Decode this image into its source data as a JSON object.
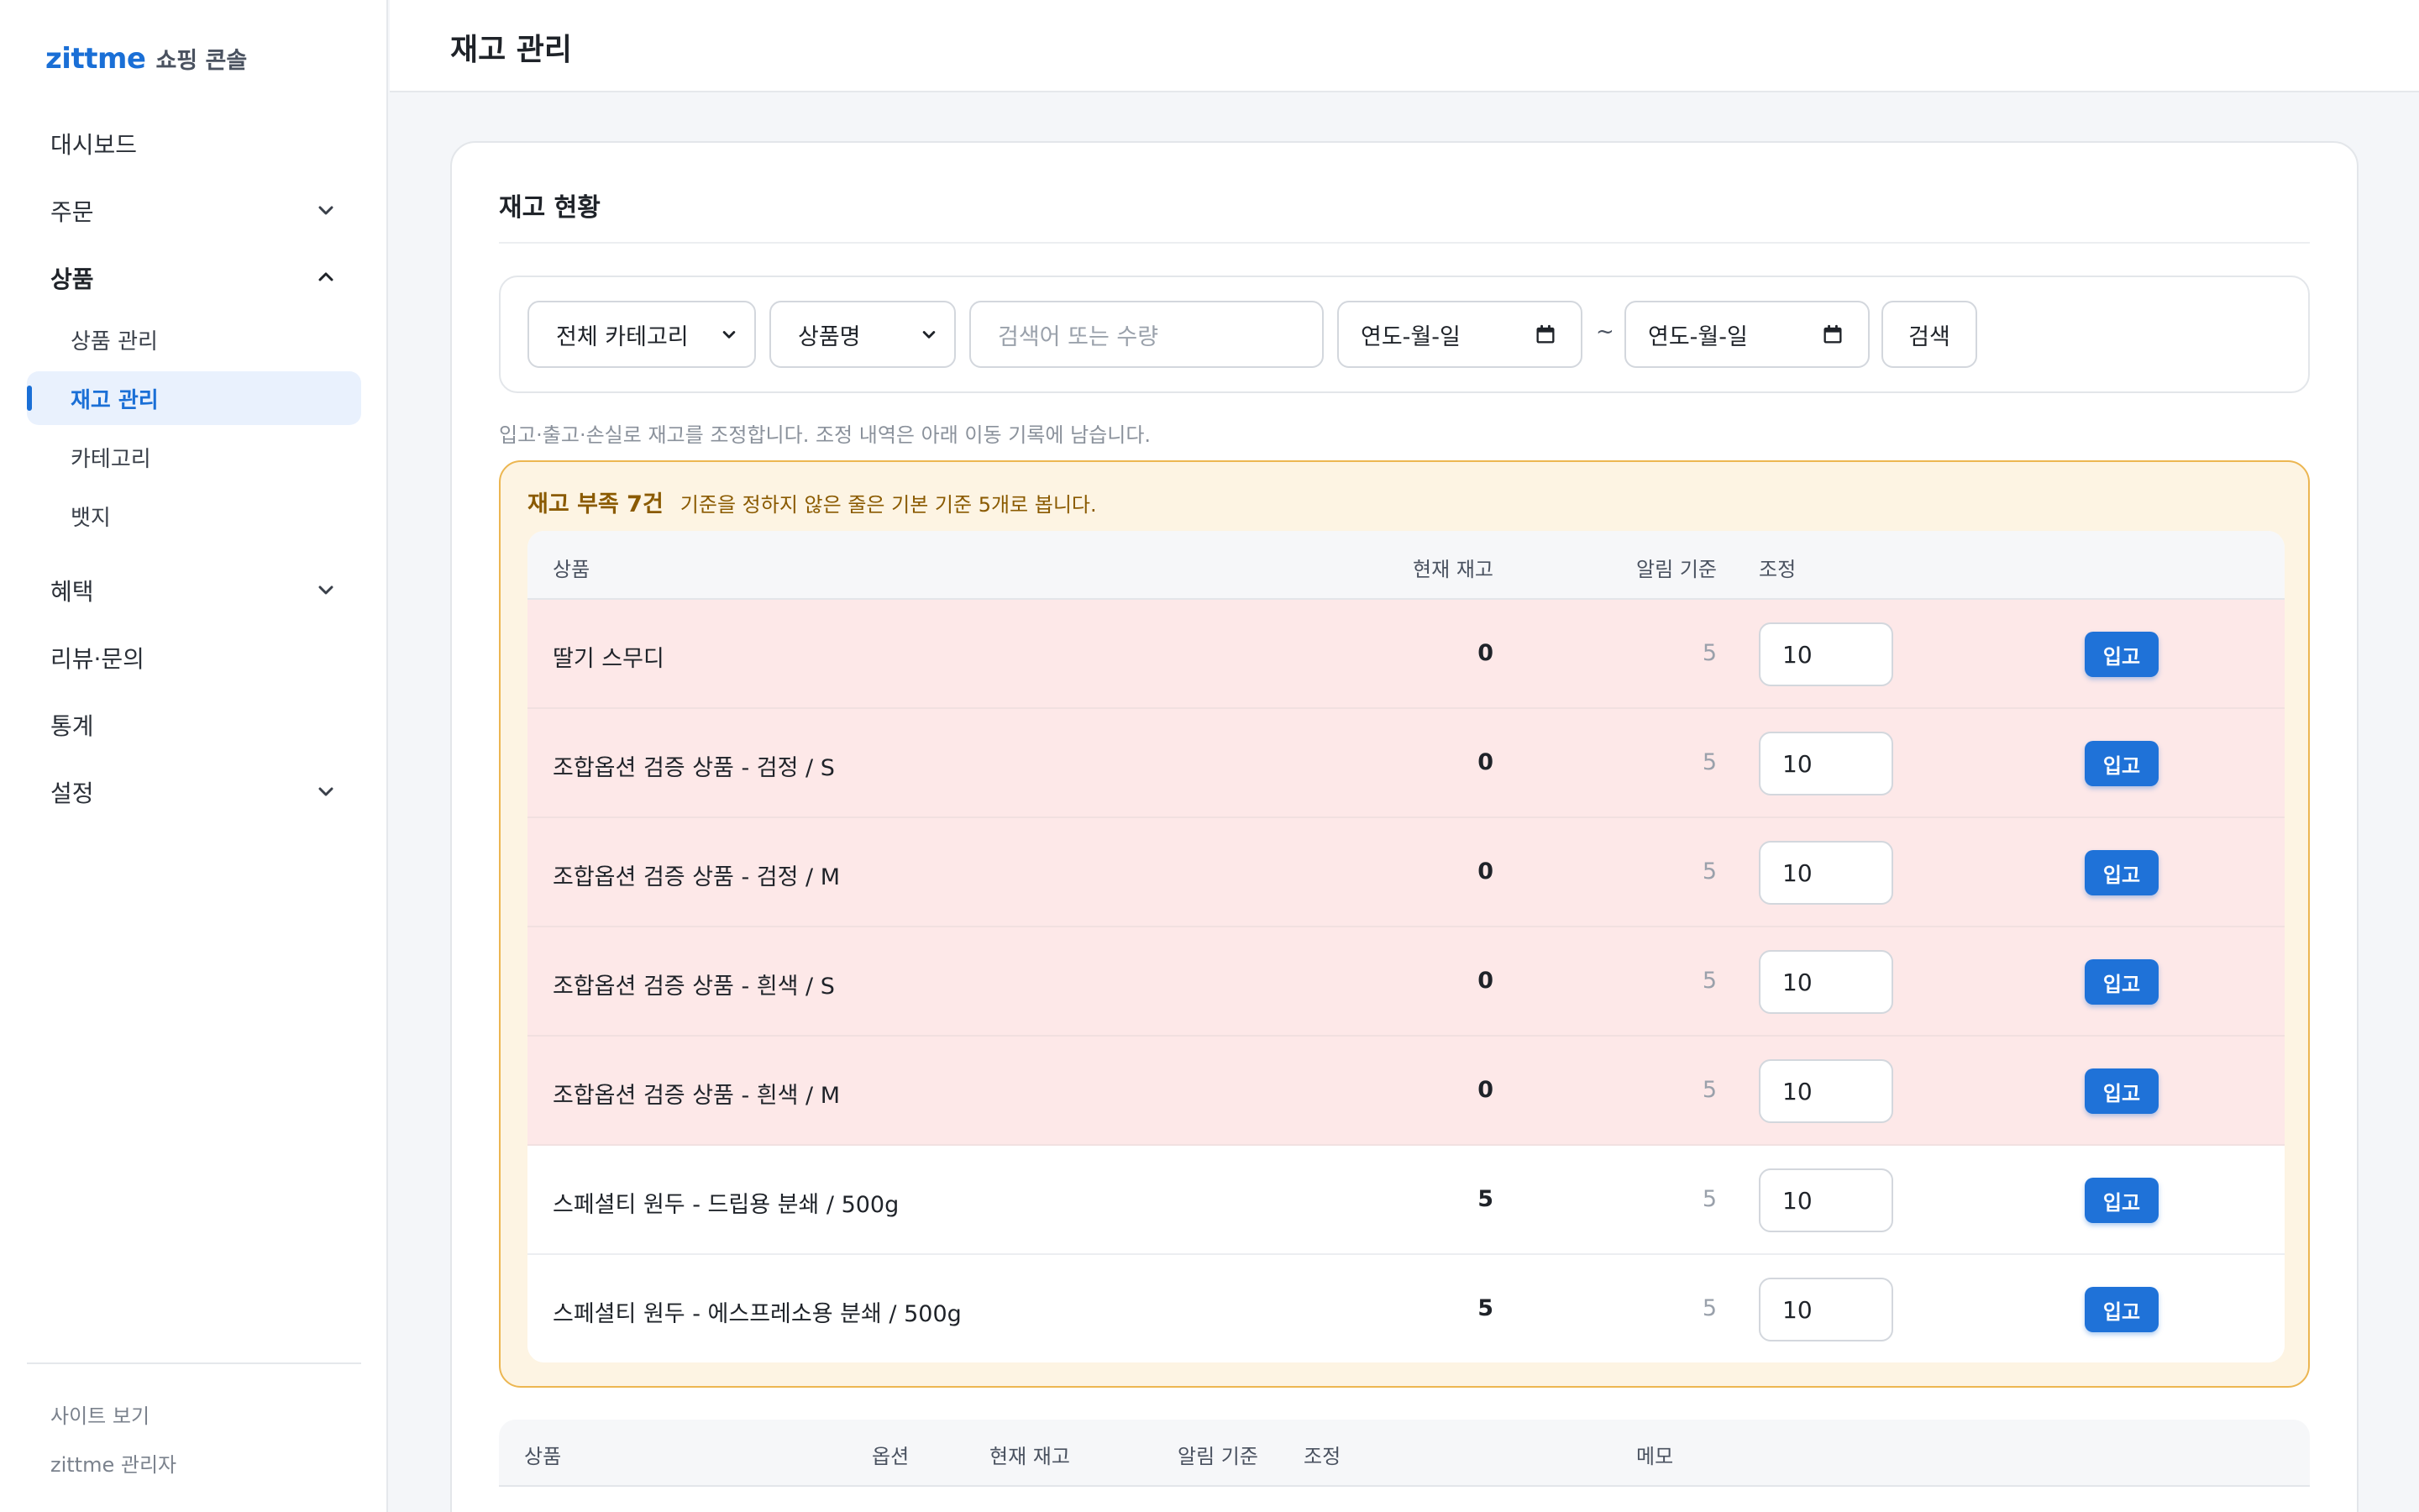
{
  "brand": {
    "logo": "zittme",
    "subtitle": "쇼핑 콘솔"
  },
  "sidebar": {
    "items": [
      {
        "label": "대시보드",
        "has_chevron": false
      },
      {
        "label": "주문",
        "has_chevron": true,
        "chevron": "chevron-down-icon"
      },
      {
        "label": "상품",
        "has_chevron": true,
        "chevron": "chevron-up-icon",
        "open": true,
        "children": [
          "상품 관리",
          "재고 관리",
          "카테고리",
          "뱃지"
        ],
        "active_child": "재고 관리"
      },
      {
        "label": "혜택",
        "has_chevron": true,
        "chevron": "chevron-down-icon"
      },
      {
        "label": "리뷰·문의",
        "has_chevron": false
      },
      {
        "label": "통계",
        "has_chevron": false
      },
      {
        "label": "설정",
        "has_chevron": true,
        "chevron": "chevron-down-icon"
      }
    ],
    "footer": {
      "view_site": "사이트 보기",
      "admin_name": "zittme 관리자"
    }
  },
  "header": {
    "title": "재고 관리"
  },
  "card": {
    "title": "재고 현황",
    "filter": {
      "category_select": "전체 카테고리",
      "field_select": "상품명",
      "search_placeholder": "검색어 또는 수량",
      "date_from_placeholder": "연도-월-일",
      "date_separator": "~",
      "date_to_placeholder": "연도-월-일",
      "search_button": "검색"
    },
    "hint": "입고·출고·손실로 재고를 조정합니다. 조정 내역은 아래 이동 기록에 남습니다."
  },
  "low_stock": {
    "title": "재고 부족 7건",
    "description": "기준을 정하지 않은 줄은 기본 기준 5개로 봅니다.",
    "columns": {
      "product": "상품",
      "stock": "현재 재고",
      "threshold": "알림 기준",
      "adjust": "조정"
    },
    "rows": [
      {
        "name": "딸기 스무디",
        "stock": "0",
        "threshold": "5",
        "qty": "10",
        "button": "입고"
      },
      {
        "name": "조합옵션 검증 상품 - 검정 / S",
        "stock": "0",
        "threshold": "5",
        "qty": "10",
        "button": "입고"
      },
      {
        "name": "조합옵션 검증 상품 - 검정 / M",
        "stock": "0",
        "threshold": "5",
        "qty": "10",
        "button": "입고"
      },
      {
        "name": "조합옵션 검증 상품 - 흰색 / S",
        "stock": "0",
        "threshold": "5",
        "qty": "10",
        "button": "입고"
      },
      {
        "name": "조합옵션 검증 상품 - 흰색 / M",
        "stock": "0",
        "threshold": "5",
        "qty": "10",
        "button": "입고"
      },
      {
        "name": "스페셜티 원두 - 드립용 분쇄 / 500g",
        "stock": "5",
        "threshold": "5",
        "qty": "10",
        "button": "입고"
      },
      {
        "name": "스페셜티 원두 - 에스프레소용 분쇄 / 500g",
        "stock": "5",
        "threshold": "5",
        "qty": "10",
        "button": "입고"
      }
    ]
  },
  "main_table": {
    "columns": {
      "product": "상품",
      "option": "옵션",
      "stock": "현재 재고",
      "threshold": "알림 기준",
      "adjust": "조정",
      "memo": "메모"
    }
  },
  "colors": {
    "accent": "#1a6fd6",
    "button": "#1f72d8",
    "alert_bg": "#fdf4e3",
    "alert_border": "#ecb651",
    "alert_text": "#8a5a00",
    "zero_stock_row": "#fde8e8"
  }
}
